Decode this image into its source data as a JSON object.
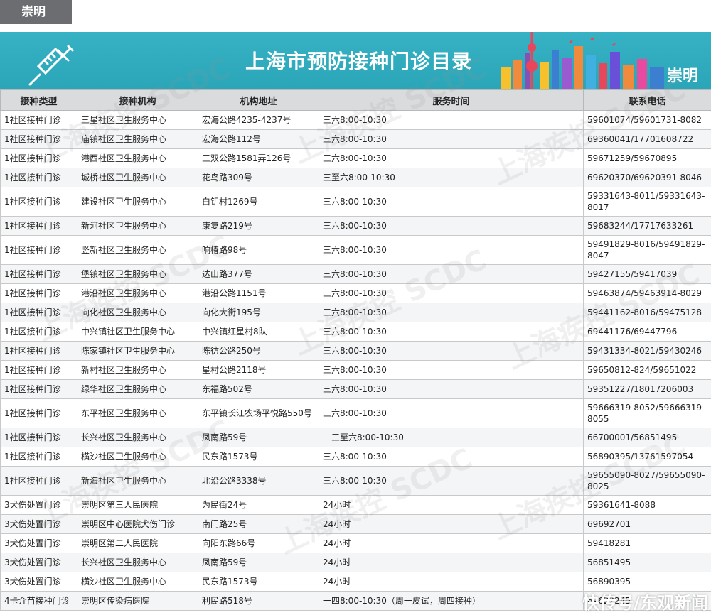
{
  "tag": "崇明",
  "banner": {
    "title": "上海市预防接种门诊目录",
    "district": "崇明"
  },
  "table": {
    "headers": [
      "接种类型",
      "接种机构",
      "机构地址",
      "服务时间",
      "联系电话"
    ],
    "rows": [
      [
        "1社区接种门诊",
        "三星社区卫生服务中心",
        "宏海公路4235-4237号",
        "三六8:00-10:30",
        "59601074/59601731-8082"
      ],
      [
        "1社区接种门诊",
        "庙镇社区卫生服务中心",
        "宏海公路112号",
        "三六8:00-10:30",
        "69360041/17701608722"
      ],
      [
        "1社区接种门诊",
        "港西社区卫生服务中心",
        "三双公路1581弄126号",
        "三六8:00-10:30",
        "59671259/59670895"
      ],
      [
        "1社区接种门诊",
        "城桥社区卫生服务中心",
        "花鸟路309号",
        "三至六8:00-10:30",
        "69620370/69620391-8046"
      ],
      [
        "1社区接种门诊",
        "建设社区卫生服务中心",
        "白钥村1269号",
        "三六8:00-10:30",
        "59331643-8011/59331643-8017"
      ],
      [
        "1社区接种门诊",
        "新河社区卫生服务中心",
        "康复路219号",
        "三六8:00-10:30",
        "59683244/17717633261"
      ],
      [
        "1社区接种门诊",
        "竖新社区卫生服务中心",
        "响椿路98号",
        "三六8:00-10:30",
        "59491829-8016/59491829-8047"
      ],
      [
        "1社区接种门诊",
        "堡镇社区卫生服务中心",
        "达山路377号",
        "三六8:00-10:30",
        "59427155/59417039"
      ],
      [
        "1社区接种门诊",
        "港沿社区卫生服务中心",
        "港沿公路1151号",
        "三六8:00-10:30",
        "59463874/59463914-8029"
      ],
      [
        "1社区接种门诊",
        "向化社区卫生服务中心",
        "向化大街195号",
        "三六8:00-10:30",
        "59441162-8016/59475128"
      ],
      [
        "1社区接种门诊",
        "中兴镇社区卫生服务中心",
        "中兴镇红星村8队",
        "三六8:00-10:30",
        "69441176/69447796"
      ],
      [
        "1社区接种门诊",
        "陈家镇社区卫生服务中心",
        "陈彷公路250号",
        "三六8:00-10:30",
        "59431334-8021/59430246"
      ],
      [
        "1社区接种门诊",
        "新村社区卫生服务中心",
        "星村公路2118号",
        "三六8:00-10:30",
        "59650812-824/59651022"
      ],
      [
        "1社区接种门诊",
        "绿华社区卫生服务中心",
        "东福路502号",
        "三六8:00-10:30",
        "59351227/18017206003"
      ],
      [
        "1社区接种门诊",
        "东平社区卫生服务中心",
        "东平镇长江农场平悦路550号",
        "三六8:00-10:30",
        "59666319-8052/59666319-8055"
      ],
      [
        "1社区接种门诊",
        "长兴社区卫生服务中心",
        "凤南路59号",
        "一三至六8:00-10:30",
        "66700001/56851495"
      ],
      [
        "1社区接种门诊",
        "横沙社区卫生服务中心",
        "民东路1573号",
        "三六8:00-10:30",
        "56890395/13761597054"
      ],
      [
        "1社区接种门诊",
        "新海社区卫生服务中心",
        "北沿公路3338号",
        "三六8:00-10:30",
        "59655090-8027/59655090-8025"
      ],
      [
        "3犬伤处置门诊",
        "崇明区第三人民医院",
        "为民街24号",
        "24小时",
        "59361641-8088"
      ],
      [
        "3犬伤处置门诊",
        "崇明区中心医院犬伤门诊",
        "南门路25号",
        "24小时",
        "69692701"
      ],
      [
        "3犬伤处置门诊",
        "崇明区第二人民医院",
        "向阳东路66号",
        "24小时",
        "59418281"
      ],
      [
        "3犬伤处置门诊",
        "长兴社区卫生服务中心",
        "凤南路59号",
        "24小时",
        "56851495"
      ],
      [
        "3犬伤处置门诊",
        "横沙社区卫生服务中心",
        "民东路1573号",
        "24小时",
        "56890395"
      ],
      [
        "4卡介苗接种门诊",
        "崇明区传染病医院",
        "利民路518号",
        "一四8:00-10:30（周一皮试，周四接种）",
        "69622245"
      ]
    ],
    "tall_rows": [
      4,
      6,
      14,
      17
    ]
  },
  "watermark": "上海疾控 SCDC",
  "corner_text": "快传号/东观新闻"
}
